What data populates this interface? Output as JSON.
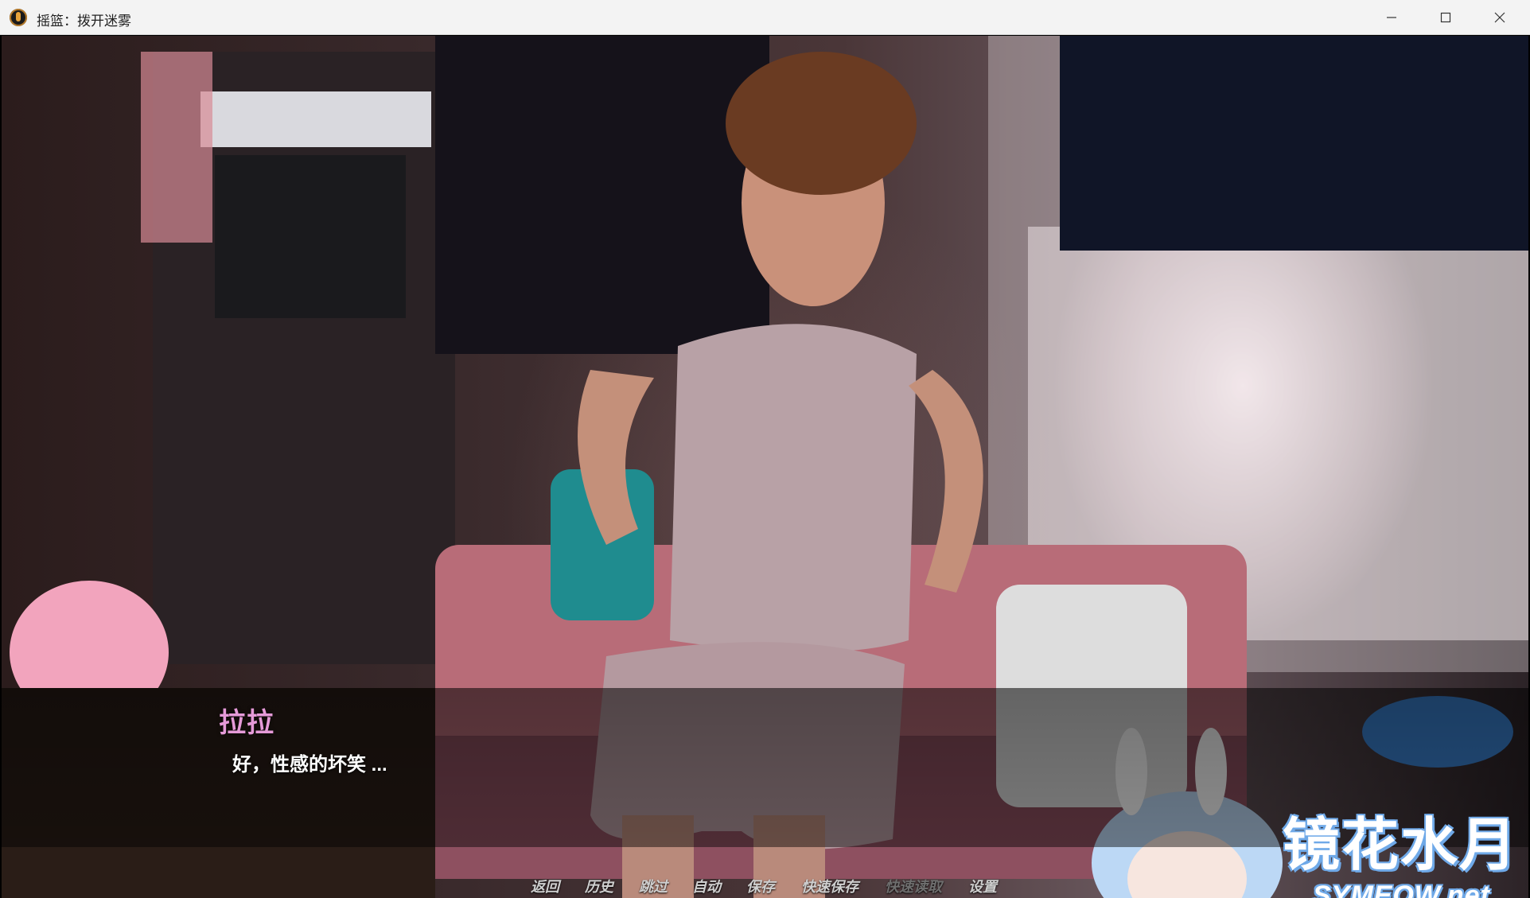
{
  "window": {
    "title": "摇篮：拨开迷雾"
  },
  "dialogue": {
    "speaker": "拉拉",
    "text": "好，性感的坏笑 ..."
  },
  "quick_menu": {
    "items": [
      {
        "label": "返回",
        "enabled": true
      },
      {
        "label": "历史",
        "enabled": true
      },
      {
        "label": "跳过",
        "enabled": true
      },
      {
        "label": "自动",
        "enabled": true
      },
      {
        "label": "保存",
        "enabled": true
      },
      {
        "label": "快速保存",
        "enabled": true
      },
      {
        "label": "快速读取",
        "enabled": false
      },
      {
        "label": "设置",
        "enabled": true
      }
    ]
  },
  "watermark": {
    "logo_text": "镜花水月",
    "url_text": "SYMEOW.net"
  },
  "colors": {
    "speaker": "#e59ad8",
    "titlebar": "#f3f3f3",
    "watermark_outline": "#6fa9e8"
  }
}
